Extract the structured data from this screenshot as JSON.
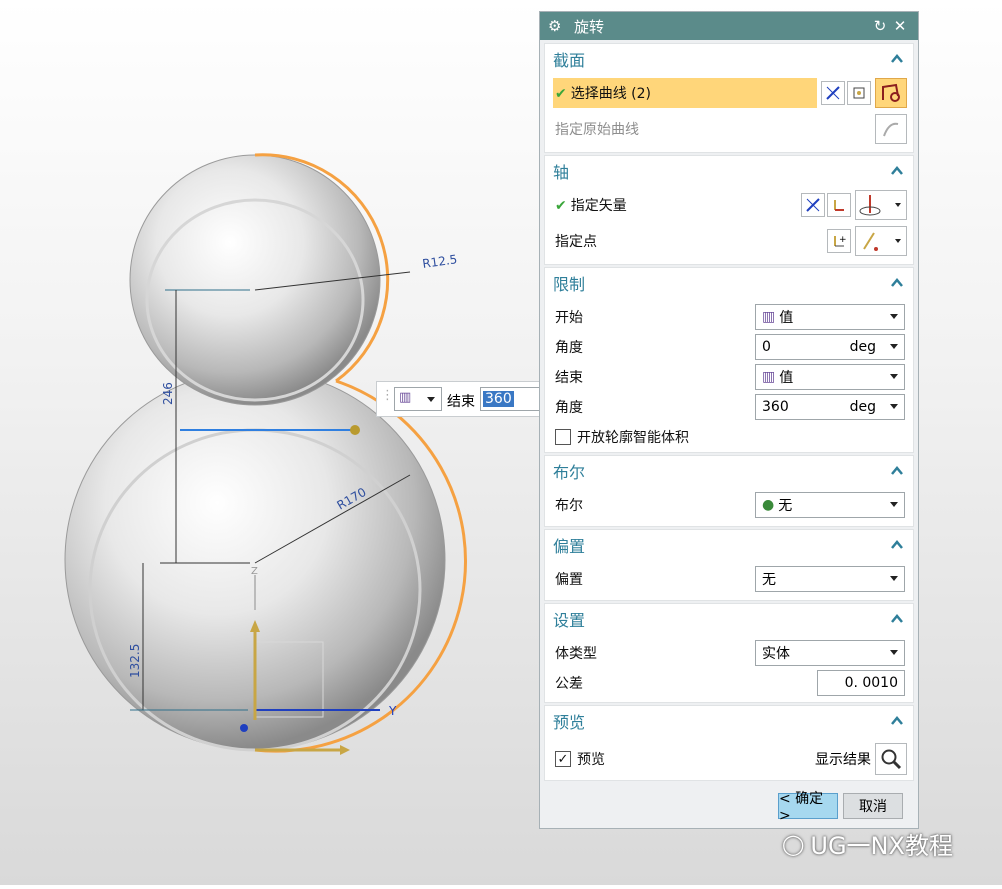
{
  "dialog": {
    "title": "旋转",
    "icons": {
      "settings": "gear-icon",
      "reset": "reset-icon",
      "close": "close-icon"
    }
  },
  "sections": {
    "section": {
      "title": "截面",
      "select_curve": "选择曲线 (2)",
      "origin_curve": "指定原始曲线"
    },
    "axis": {
      "title": "轴",
      "vector": "指定矢量",
      "point": "指定点"
    },
    "limits": {
      "title": "限制",
      "start_label": "开始",
      "start_value": "值",
      "start_angle_label": "角度",
      "start_angle": "0",
      "start_unit": "deg",
      "end_label": "结束",
      "end_value": "值",
      "end_angle_label": "角度",
      "end_angle": "360",
      "end_unit": "deg",
      "open_profile": "开放轮廓智能体积"
    },
    "boolean": {
      "title": "布尔",
      "label": "布尔",
      "value": "无"
    },
    "offset": {
      "title": "偏置",
      "label": "偏置",
      "value": "无"
    },
    "settings": {
      "title": "设置",
      "body_type_label": "体类型",
      "body_type": "实体",
      "tolerance_label": "公差",
      "tolerance": "0. 0010"
    },
    "preview": {
      "title": "预览",
      "checkbox": "预览",
      "show_result": "显示结果"
    }
  },
  "buttons": {
    "ok": "< 确定 >",
    "cancel": "取消"
  },
  "float_toolbar": {
    "label": "结束",
    "value": "360"
  },
  "dimensions": {
    "r1": "R12.5",
    "r2": "R170",
    "d1": "246",
    "d2": "132.5"
  },
  "axes": {
    "y": "Y",
    "z": "Z"
  },
  "watermark": "UG一NX教程",
  "colors": {
    "title_bar": "#5b8b8a",
    "accent": "#2f7f9a",
    "highlight": "#ffd67a",
    "curve": "#f5a142"
  }
}
